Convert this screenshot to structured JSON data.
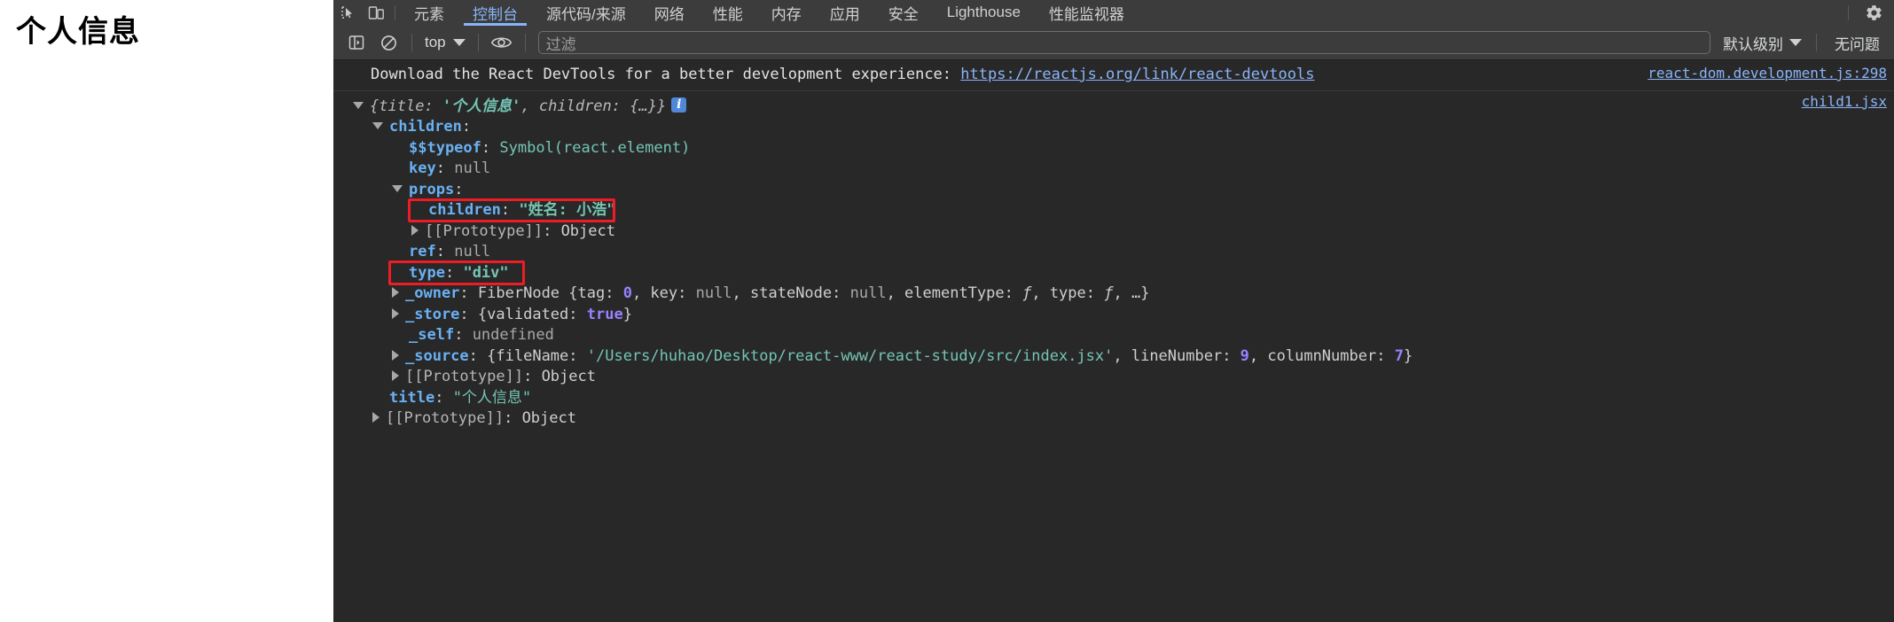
{
  "webpage": {
    "heading": "个人信息"
  },
  "devtools": {
    "tabs": [
      {
        "label": "元素",
        "active": false
      },
      {
        "label": "控制台",
        "active": true
      },
      {
        "label": "源代码/来源",
        "active": false
      },
      {
        "label": "网络",
        "active": false
      },
      {
        "label": "性能",
        "active": false
      },
      {
        "label": "内存",
        "active": false
      },
      {
        "label": "应用",
        "active": false
      },
      {
        "label": "安全",
        "active": false
      },
      {
        "label": "Lighthouse",
        "active": false
      },
      {
        "label": "性能监视器",
        "active": false
      }
    ],
    "icons": {
      "inspect": "inspect-element-icon",
      "device": "device-toolbar-icon",
      "settings": "gear-icon",
      "sidebar": "console-sidebar-icon",
      "clear": "clear-console-icon",
      "eye": "live-expression-icon"
    },
    "toolbar": {
      "context_value": "top",
      "filter_placeholder": "过滤",
      "filter_value": "",
      "level_label": "默认级别",
      "issues_label": "无问题"
    },
    "console": {
      "messages": [
        {
          "text_before": "Download the React DevTools for a better development experience: ",
          "link_text": "https://reactjs.org/link/react-devtools",
          "source": "react-dom.development.js:298"
        }
      ],
      "object_source": "child1.jsx",
      "tree": {
        "summary_open": "{",
        "summary_title_key": "title",
        "summary_title_value": "'个人信息'",
        "summary_children_key": "children",
        "summary_children_value": "{…}",
        "summary_close": "}",
        "info_badge": "i",
        "rows": [
          {
            "indent": 1,
            "arrow": "down",
            "key": "children",
            "sep": ":",
            "value": "",
            "value_type": "plain"
          },
          {
            "indent": 2,
            "arrow": "none",
            "key": "$$typeof",
            "sep": ":",
            "value": "Symbol(react.element)",
            "value_type": "str"
          },
          {
            "indent": 2,
            "arrow": "none",
            "key": "key",
            "sep": ":",
            "value": "null",
            "value_type": "null"
          },
          {
            "indent": 2,
            "arrow": "down",
            "key": "props",
            "sep": ":",
            "value": "",
            "value_type": "plain"
          },
          {
            "indent": 3,
            "arrow": "none",
            "key": "children",
            "sep": ":",
            "value": "\"姓名: 小浩\"",
            "value_type": "str",
            "highlight": true
          },
          {
            "indent": 3,
            "arrow": "right",
            "key": "[[Prototype]]",
            "sep": ":",
            "value": "Object",
            "value_type": "plain",
            "key_plain": true
          },
          {
            "indent": 2,
            "arrow": "none",
            "key": "ref",
            "sep": ":",
            "value": "null",
            "value_type": "null"
          },
          {
            "indent": 2,
            "arrow": "none",
            "key": "type",
            "sep": ":",
            "value": "\"div\"",
            "value_type": "str",
            "highlight": true
          },
          {
            "indent": 2,
            "arrow": "right",
            "key": "_owner",
            "sep": ":",
            "value": "FiberNode {tag: 0, key: null, stateNode: null, elementType: ƒ, type: ƒ, …}",
            "value_type": "fiber"
          },
          {
            "indent": 2,
            "arrow": "right",
            "key": "_store",
            "sep": ":",
            "value": "{validated: true}",
            "value_type": "store"
          },
          {
            "indent": 2,
            "arrow": "none",
            "key": "_self",
            "sep": ":",
            "value": "undefined",
            "value_type": "null"
          },
          {
            "indent": 2,
            "arrow": "right",
            "key": "_source",
            "sep": ":",
            "value": "{fileName: '/Users/huhao/Desktop/react-www/react-study/src/index.jsx', lineNumber: 9, columnNumber: 7}",
            "value_type": "source"
          },
          {
            "indent": 2,
            "arrow": "right",
            "key": "[[Prototype]]",
            "sep": ":",
            "value": "Object",
            "value_type": "plain",
            "key_plain": true
          },
          {
            "indent": 1,
            "arrow": "none",
            "key": "title",
            "sep": ":",
            "value": "\"个人信息\"",
            "value_type": "str"
          },
          {
            "indent": 1,
            "arrow": "right",
            "key": "[[Prototype]]",
            "sep": ":",
            "value": "Object",
            "value_type": "plain",
            "key_plain": true
          }
        ],
        "source_parts": {
          "open": "{fileName: ",
          "filename": "'/Users/huhao/Desktop/react-www/react-study/src/index.jsx'",
          "mid1": ", lineNumber: ",
          "linenumber": "9",
          "mid2": ", columnNumber: ",
          "columnnumber": "7",
          "close": "}"
        },
        "fiber_parts": {
          "name": "FiberNode {tag: ",
          "tag": "0",
          "p1": ", key: ",
          "key": "null",
          "p2": ", stateNode: ",
          "statenode": "null",
          "p3": ", elementType: ",
          "elementtype": "ƒ",
          "p4": ", type: ",
          "type": "ƒ",
          "p5": ", …}"
        },
        "store_parts": {
          "open": "{validated: ",
          "validated": "true",
          "close": "}"
        }
      }
    }
  },
  "colors": {
    "accent_blue": "#8ab4f8",
    "highlight_red": "#ee1c25",
    "string_teal": "#74c5b4",
    "key_blue": "#6ab0f3",
    "number_purple": "#9980ff",
    "panel_bg": "#282828",
    "toolbar_bg": "#3c3c3c"
  }
}
